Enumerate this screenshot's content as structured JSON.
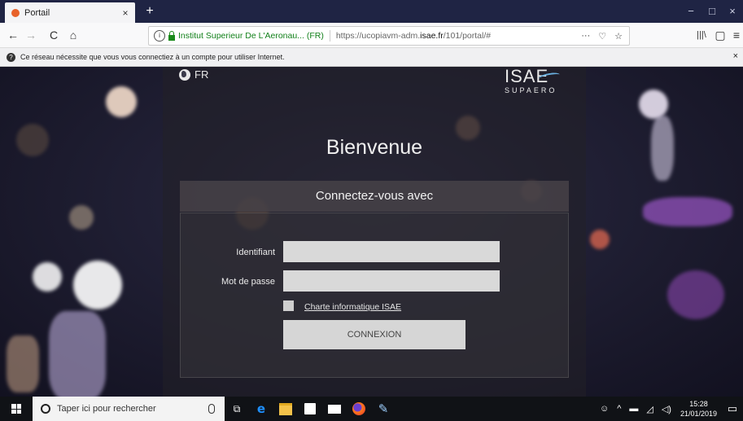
{
  "browser": {
    "tab_title": "Portail",
    "tab_close": "×",
    "new_tab": "+",
    "window_controls": [
      "−",
      "□",
      "×"
    ],
    "nav": {
      "back": "←",
      "forward": "→",
      "reload": "C",
      "home": "⌂"
    },
    "url": {
      "site_identity": "Institut Superieur De L'Aeronau... (FR)",
      "prefix": "https://ucopiavm-adm.",
      "domain": "isae.fr",
      "path": "/101/portal/#"
    },
    "url_tools": [
      "···",
      "♡",
      "☆"
    ],
    "toolbar_right": [
      "|||\\",
      "▢",
      "≡"
    ],
    "infobar_text": "Ce réseau nécessite que vous vous connectiez à un compte pour utiliser Internet.",
    "infobar_close": "×"
  },
  "portal": {
    "language": "FR",
    "logo_main": "ISAE",
    "logo_sub": "SUPAERO",
    "welcome": "Bienvenue",
    "login_header": "Connectez-vous avec",
    "username_label": "Identifiant",
    "username_value": "",
    "password_label": "Mot de passe",
    "password_value": "",
    "charter_link": "Charte informatique ISAE",
    "submit_label": "CONNEXION"
  },
  "taskbar": {
    "search_placeholder": "Taper ici pour rechercher",
    "apps": [
      "task-view",
      "edge",
      "file-explorer",
      "store",
      "mail",
      "firefox",
      "paint"
    ],
    "time": "15:28",
    "date": "21/01/2019"
  },
  "colors": {
    "tabbar_bg": "#1f2444",
    "portal_button_bg": "#d6d6d6",
    "taskbar_bg": "#101216",
    "favicon": "#e8622a",
    "secure_green": "#12801a"
  }
}
